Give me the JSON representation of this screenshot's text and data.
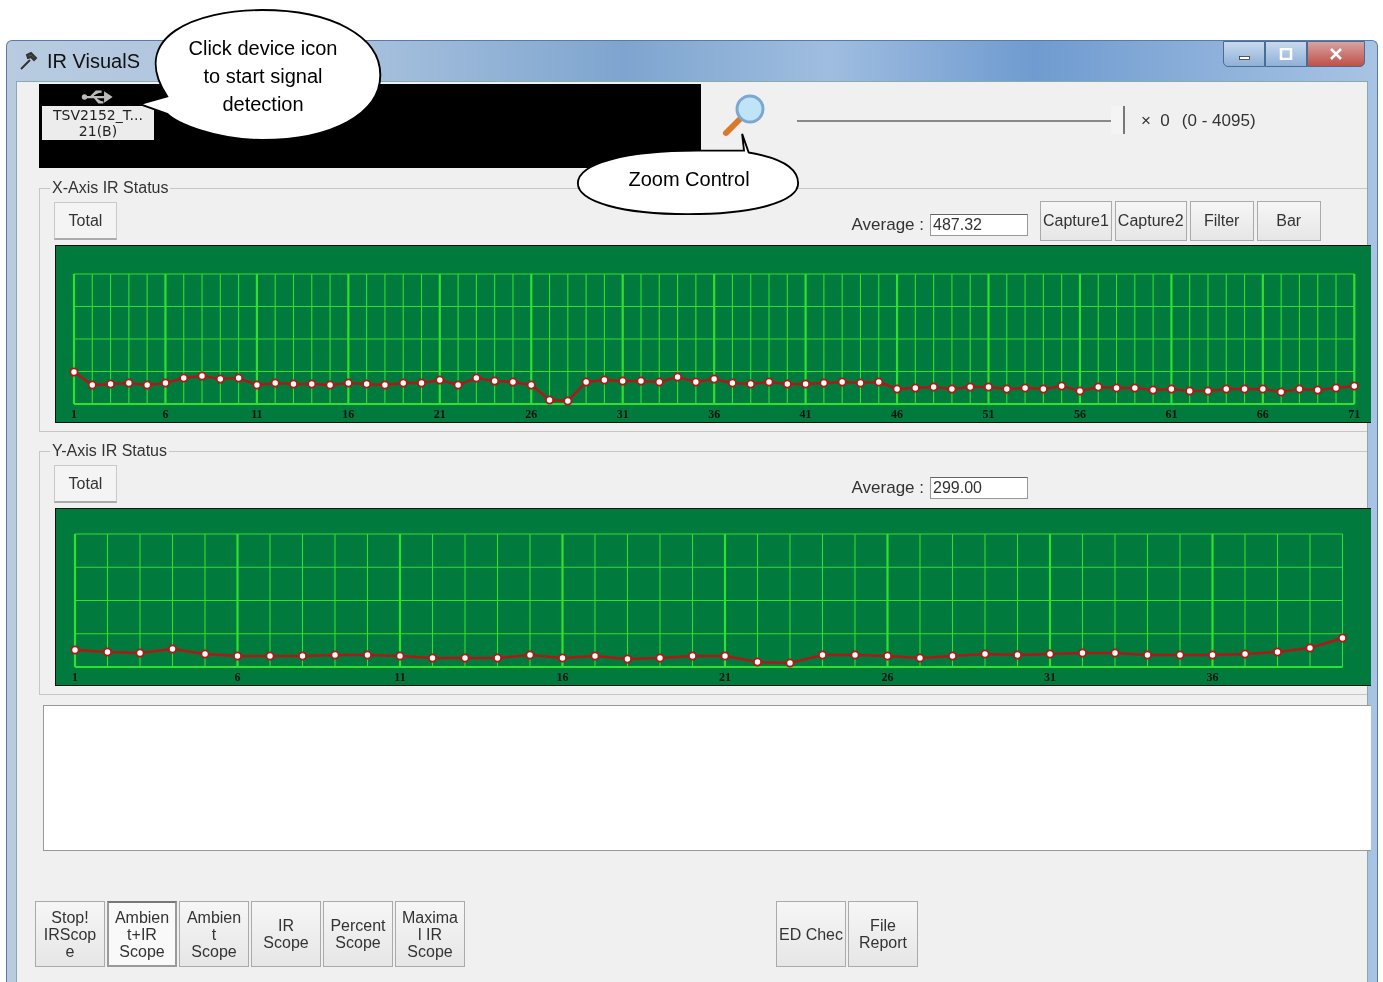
{
  "window": {
    "title": "IR VisualS"
  },
  "callouts": [
    {
      "text": "Click device icon to start signal detection"
    },
    {
      "text": "Zoom Control"
    }
  ],
  "device": {
    "lines": [
      "TSV2152_T...",
      "21(B)"
    ]
  },
  "zoom": {
    "level": 1,
    "reading": "×  0",
    "range": "(0 - 4095)"
  },
  "x_axis": {
    "title": "X-Axis IR Status",
    "tab": "Total",
    "average_label": "Average :",
    "average": "487.32",
    "buttons": [
      "Capture1",
      "Capture2",
      "Filter",
      "Bar"
    ],
    "x_labels": [
      "1",
      "6",
      "11",
      "16",
      "21",
      "26",
      "31",
      "36",
      "41",
      "46",
      "51",
      "56",
      "61",
      "66",
      "71"
    ]
  },
  "y_axis": {
    "title": "Y-Axis IR Status",
    "tab": "Total",
    "average_label": "Average :",
    "average": "299.00",
    "x_labels": [
      "1",
      "6",
      "11",
      "16",
      "21",
      "26",
      "31",
      "36"
    ]
  },
  "scope_buttons": [
    {
      "lines": [
        "Stop!",
        "IRScop",
        "e"
      ],
      "selected": false
    },
    {
      "lines": [
        "Ambien",
        "t+IR",
        "Scope"
      ],
      "selected": true
    },
    {
      "lines": [
        "Ambien",
        "t",
        "Scope"
      ],
      "selected": false
    },
    {
      "lines": [
        "IR",
        "Scope"
      ],
      "selected": false
    },
    {
      "lines": [
        "Percent",
        "Scope"
      ],
      "selected": false
    },
    {
      "lines": [
        "Maxima",
        "l IR",
        "Scope"
      ],
      "selected": false
    }
  ],
  "report_buttons": [
    {
      "lines": [
        "ED Chec"
      ]
    },
    {
      "lines": [
        "File",
        "Report"
      ]
    }
  ]
}
